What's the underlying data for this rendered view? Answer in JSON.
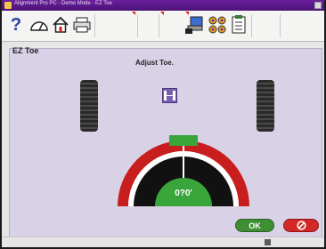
{
  "window": {
    "title": "Alignment Pro PC - Demo Mode - EZ Toe"
  },
  "toolbar": {
    "buttons": [
      {
        "icon": "help-icon",
        "label": "?"
      },
      {
        "icon": "speedometer-icon"
      },
      {
        "icon": "home-icon"
      },
      {
        "icon": "printer-icon"
      },
      {
        "icon": "blank"
      },
      {
        "icon": "blank"
      },
      {
        "icon": "blank"
      },
      {
        "icon": "computer-icon"
      },
      {
        "icon": "wheel-set-icon"
      },
      {
        "icon": "checklist-icon"
      }
    ]
  },
  "panel": {
    "title": "EZ Toe",
    "heading": "Adjust Toe."
  },
  "gauge": {
    "value": "0?0'",
    "needle_position": 0.5,
    "colors": {
      "ok": "#3aa53a",
      "limit": "#c81e1e",
      "face": "#111111"
    }
  },
  "buttons": {
    "ok_label": "OK",
    "cancel_icon": "no-symbol-icon"
  },
  "colors": {
    "titlebar": "#5b1a88",
    "panel": "#d9d2e6",
    "ok": "#3e8f34",
    "cancel": "#d42828"
  }
}
